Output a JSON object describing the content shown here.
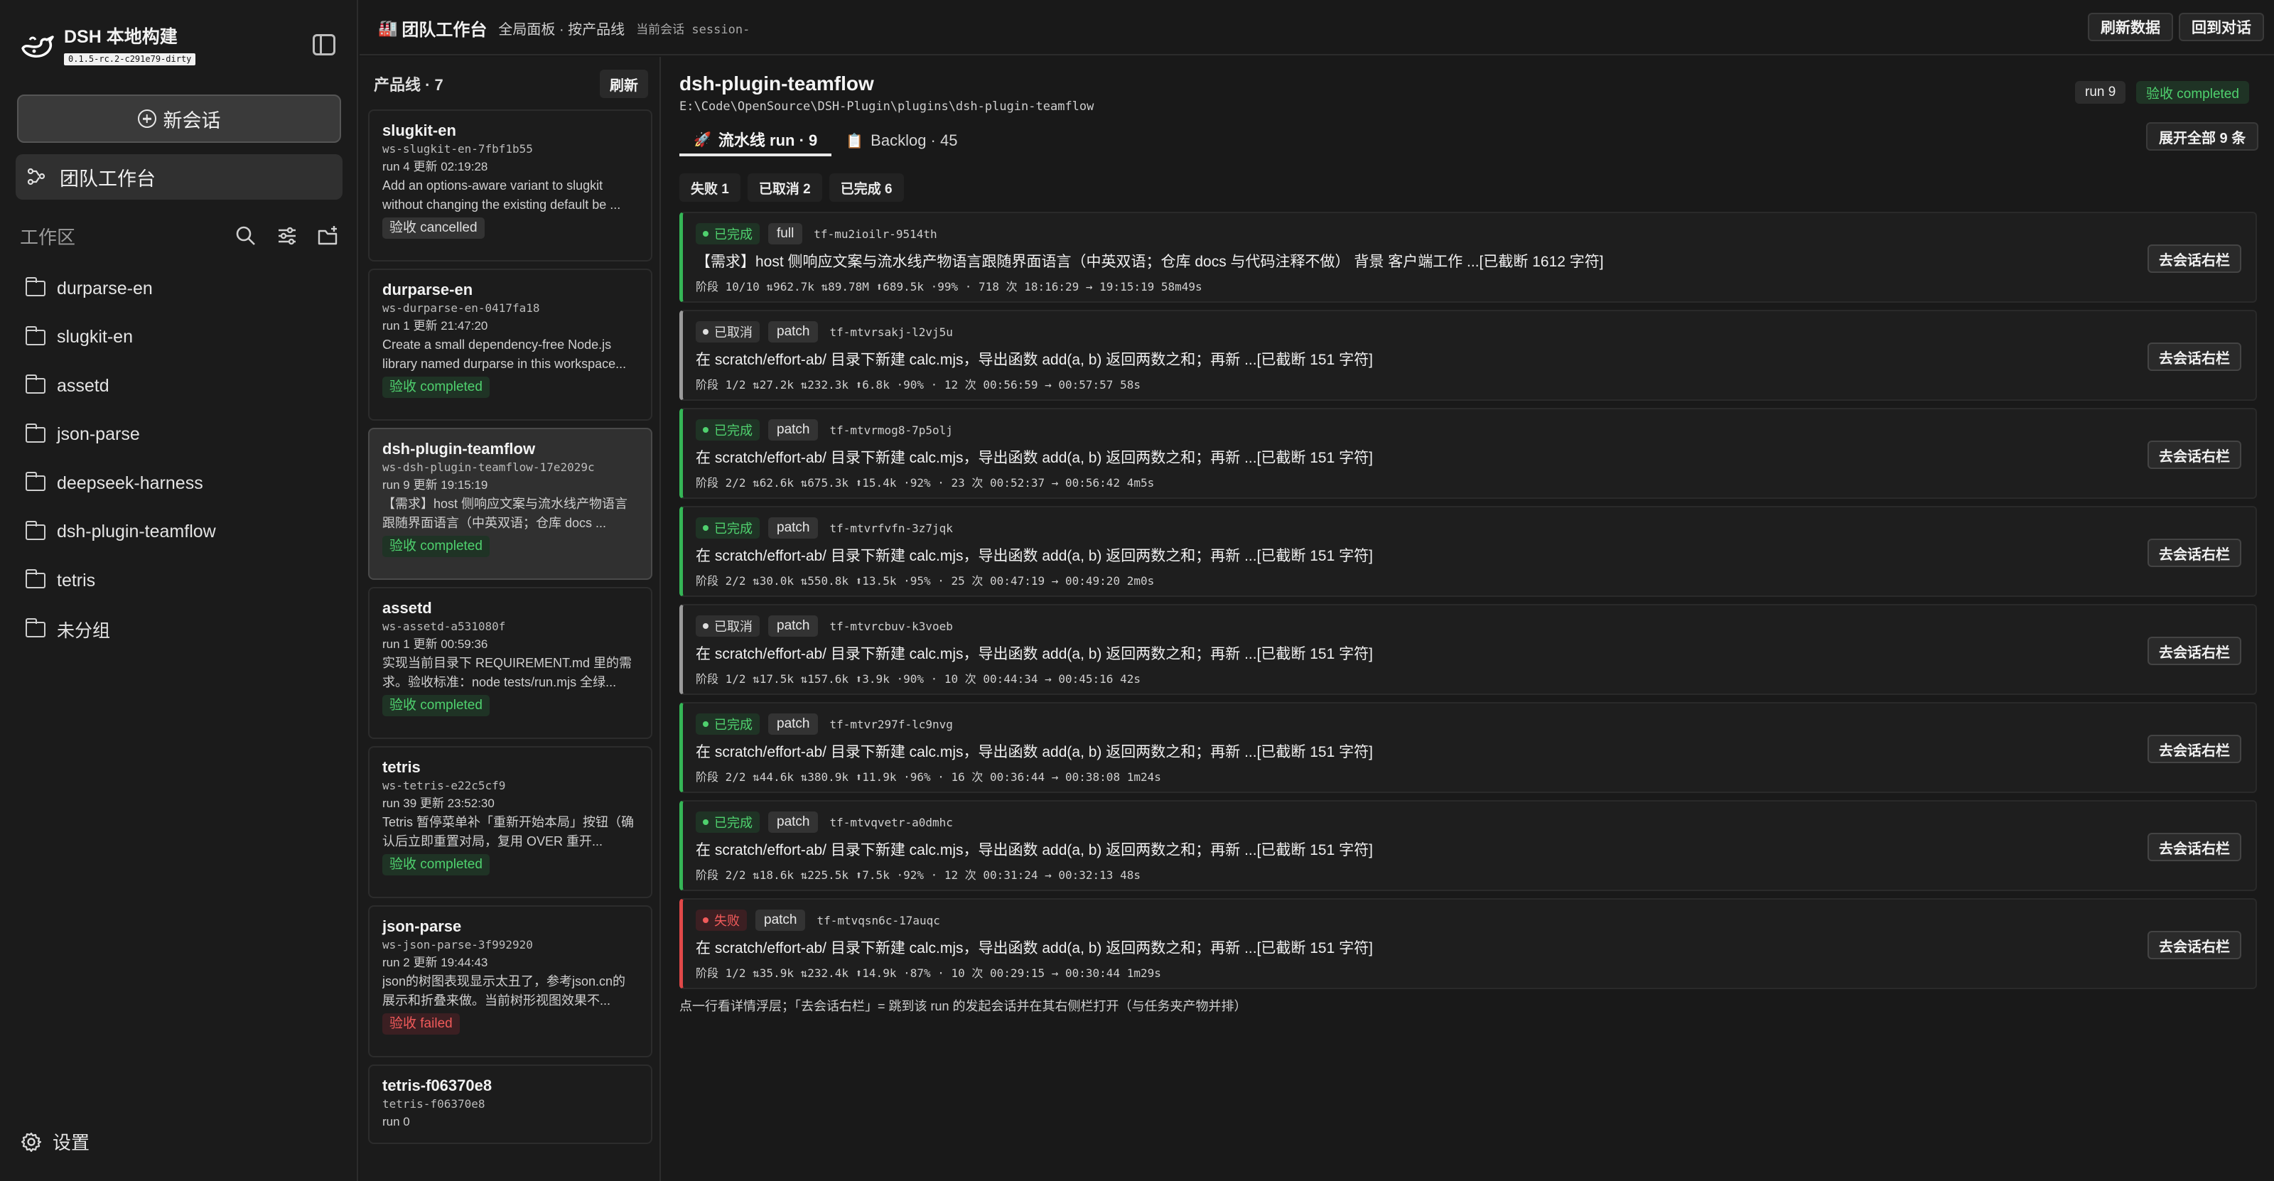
{
  "app": {
    "brand_title": "DSH 本地构建",
    "brand_version": "0.1.5-rc.2-c291e79-dirty"
  },
  "sidebar": {
    "new_chat": "新会话",
    "team_workbench": "团队工作台",
    "workspace_label": "工作区",
    "workspaces": [
      "durparse-en",
      "slugkit-en",
      "assetd",
      "json-parse",
      "deepseek-harness",
      "dsh-plugin-teamflow",
      "tetris",
      "未分组"
    ],
    "settings": "设置"
  },
  "topbar": {
    "title": "团队工作台",
    "subtitle": "全局面板 · 按产品线",
    "session": "当前会话 session-",
    "refresh_data": "刷新数据",
    "back_to_chat": "回到对话"
  },
  "products": {
    "title": "产品线 · 7",
    "refresh": "刷新",
    "items": [
      {
        "name": "slugkit-en",
        "ws": "ws-slugkit-en-7fbf1b55",
        "meta": "run 4   更新 02:19:28",
        "desc": "Add an options-aware variant to slugkit without changing the existing default be ...",
        "status": "验收 cancelled",
        "status_kind": "cancelled"
      },
      {
        "name": "durparse-en",
        "ws": "ws-durparse-en-0417fa18",
        "meta": "run 1   更新 21:47:20",
        "desc": "Create a small dependency-free Node.js library named durparse in this workspace...",
        "status": "验收 completed",
        "status_kind": "completed"
      },
      {
        "name": "dsh-plugin-teamflow",
        "ws": "ws-dsh-plugin-teamflow-17e2029c",
        "meta": "run 9   更新 19:15:19",
        "desc": "【需求】host 侧响应文案与流水线产物语言跟随界面语言（中英双语；仓库 docs ...",
        "status": "验收 completed",
        "status_kind": "completed"
      },
      {
        "name": "assetd",
        "ws": "ws-assetd-a531080f",
        "meta": "run 1   更新 00:59:36",
        "desc": "实现当前目录下 REQUIREMENT.md 里的需求。验收标准：node tests/run.mjs 全绿...",
        "status": "验收 completed",
        "status_kind": "completed"
      },
      {
        "name": "tetris",
        "ws": "ws-tetris-e22c5cf9",
        "meta": "run 39   更新 23:52:30",
        "desc": "Tetris 暂停菜单补「重新开始本局」按钮（确认后立即重置对局，复用 OVER 重开...",
        "status": "验收 completed",
        "status_kind": "completed"
      },
      {
        "name": "json-parse",
        "ws": "ws-json-parse-3f992920",
        "meta": "run 2   更新 19:44:43",
        "desc": "json的树图表现显示太丑了，参考json.cn的展示和折叠来做。当前树形视图效果不...",
        "status": "验收 failed",
        "status_kind": "failed"
      },
      {
        "name": "tetris-f06370e8",
        "ws": "tetris-f06370e8",
        "meta": "run 0",
        "desc": "",
        "status": "",
        "status_kind": ""
      }
    ]
  },
  "main": {
    "title": "dsh-plugin-teamflow",
    "path": "E:\\Code\\OpenSource\\DSH-Plugin\\plugins\\dsh-plugin-teamflow",
    "run_pill": "run 9",
    "status_pill": "验收 completed",
    "tabs": [
      {
        "icon": "🚀",
        "label": "流水线 run · 9"
      },
      {
        "icon": "📋",
        "label": "Backlog · 45"
      }
    ],
    "expand_all": "展开全部 9 条",
    "filters": [
      "失败 1",
      "已取消 2",
      "已完成 6"
    ],
    "goto_label": "去会话右栏",
    "runs": [
      {
        "status": "已完成",
        "kind": "completed",
        "type": "full",
        "id": "tf-mu2ioilr-9514th",
        "desc": "【需求】host 侧响应文案与流水线产物语言跟随界面语言（中英双语；仓库 docs 与代码注释不做） 背景 客户端工作 ...[已截断 1612 字符]",
        "stats": "阶段 10/10  ⇅962.7k ⇅89.78M ⬆689.5k ·99% · 718 次  18:16:29 → 19:15:19 58m49s"
      },
      {
        "status": "已取消",
        "kind": "cancelled",
        "type": "patch",
        "id": "tf-mtvrsakj-l2vj5u",
        "desc": "在 scratch/effort-ab/ 目录下新建 calc.mjs，导出函数 add(a, b) 返回两数之和；再新 ...[已截断 151 字符]",
        "stats": "阶段 1/2  ⇅27.2k ⇅232.3k ⬆6.8k ·90% · 12 次  00:56:59 → 00:57:57 58s"
      },
      {
        "status": "已完成",
        "kind": "completed",
        "type": "patch",
        "id": "tf-mtvrmog8-7p5olj",
        "desc": "在 scratch/effort-ab/ 目录下新建 calc.mjs，导出函数 add(a, b) 返回两数之和；再新 ...[已截断 151 字符]",
        "stats": "阶段 2/2  ⇅62.6k ⇅675.3k ⬆15.4k ·92% · 23 次  00:52:37 → 00:56:42 4m5s"
      },
      {
        "status": "已完成",
        "kind": "completed",
        "type": "patch",
        "id": "tf-mtvrfvfn-3z7jqk",
        "desc": "在 scratch/effort-ab/ 目录下新建 calc.mjs，导出函数 add(a, b) 返回两数之和；再新 ...[已截断 151 字符]",
        "stats": "阶段 2/2  ⇅30.0k ⇅550.8k ⬆13.5k ·95% · 25 次  00:47:19 → 00:49:20 2m0s"
      },
      {
        "status": "已取消",
        "kind": "cancelled",
        "type": "patch",
        "id": "tf-mtvrcbuv-k3voeb",
        "desc": "在 scratch/effort-ab/ 目录下新建 calc.mjs，导出函数 add(a, b) 返回两数之和；再新 ...[已截断 151 字符]",
        "stats": "阶段 1/2  ⇅17.5k ⇅157.6k ⬆3.9k ·90% · 10 次  00:44:34 → 00:45:16 42s"
      },
      {
        "status": "已完成",
        "kind": "completed",
        "type": "patch",
        "id": "tf-mtvr297f-lc9nvg",
        "desc": "在 scratch/effort-ab/ 目录下新建 calc.mjs，导出函数 add(a, b) 返回两数之和；再新 ...[已截断 151 字符]",
        "stats": "阶段 2/2  ⇅44.6k ⇅380.9k ⬆11.9k ·96% · 16 次  00:36:44 → 00:38:08 1m24s"
      },
      {
        "status": "已完成",
        "kind": "completed",
        "type": "patch",
        "id": "tf-mtvqvetr-a0dmhc",
        "desc": "在 scratch/effort-ab/ 目录下新建 calc.mjs，导出函数 add(a, b) 返回两数之和；再新 ...[已截断 151 字符]",
        "stats": "阶段 2/2  ⇅18.6k ⇅225.5k ⬆7.5k ·92% · 12 次  00:31:24 → 00:32:13 48s"
      },
      {
        "status": "失败",
        "kind": "failed",
        "type": "patch",
        "id": "tf-mtvqsn6c-17auqc",
        "desc": "在 scratch/effort-ab/ 目录下新建 calc.mjs，导出函数 add(a, b) 返回两数之和；再新 ...[已截断 151 字符]",
        "stats": "阶段 1/2  ⇅35.9k ⇅232.4k ⬆14.9k ·87% · 10 次  00:29:15 → 00:30:44 1m29s"
      }
    ],
    "hint": "点一行看详情浮层；「去会话右栏」= 跳到该 run 的发起会话并在其右侧栏打开（与任务夹产物并排）"
  }
}
